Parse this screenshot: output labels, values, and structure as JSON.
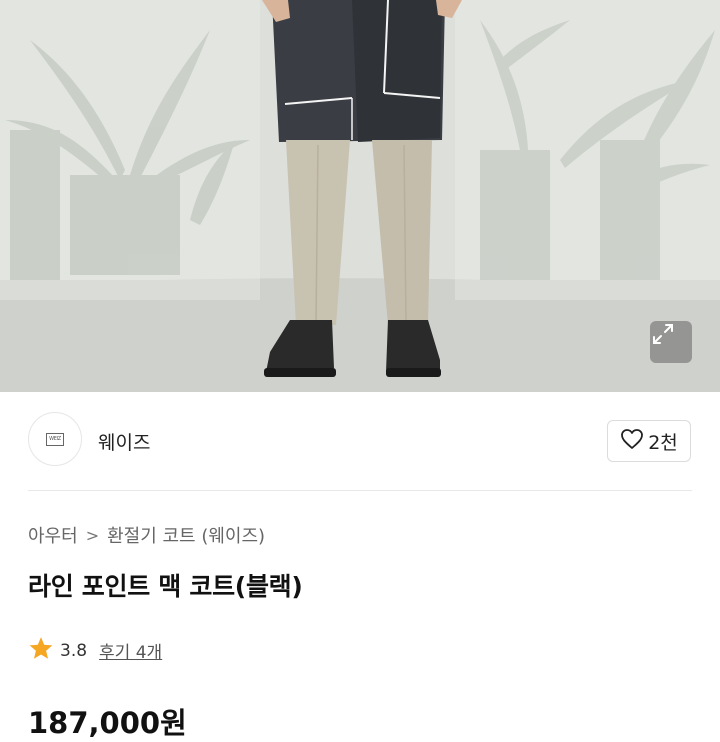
{
  "product": {
    "brand_name": "웨이즈",
    "logo_text": "WEIZ",
    "like_count": "2천",
    "breadcrumb": [
      "아우터",
      "환절기 코트 (웨이즈)"
    ],
    "breadcrumb_separator": ">",
    "title": "라인 포인트 맥 코트(블랙)",
    "rating": "3.8",
    "review_label": "후기 4개",
    "price": "187,000원"
  },
  "colors": {
    "star": "#f5a623",
    "coat": "#3a3e44",
    "trousers": "#c8c2b0",
    "boots": "#2a2a2a"
  },
  "icons": {
    "expand": "expand-icon",
    "like": "heart-outline-icon",
    "star": "star-icon",
    "chevron": "chevron-right-icon"
  }
}
